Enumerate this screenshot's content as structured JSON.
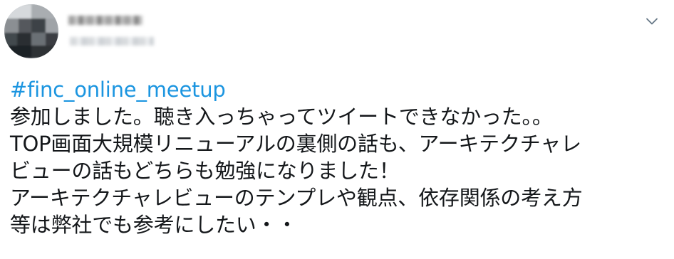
{
  "author": {
    "avatar_icon": "blurred-profile-photo",
    "display_name": "",
    "handle": ""
  },
  "menu": {
    "icon": "chevron-down-icon"
  },
  "tweet": {
    "hashtag": "#finc_online_meetup",
    "lines": [
      "参加しました。聴き入っちゃってツイートできなかった。。",
      "TOP画面大規模リニューアルの裏側の話も、アーキテクチャレ",
      "ビューの話もどちらも勉強になりました！",
      "アーキテクチャレビューのテンプレや観点、依存関係の考え方",
      "等は弊社でも参考にしたい・・"
    ]
  },
  "colors": {
    "link": "#1b95e0",
    "text": "#14171a",
    "icon": "#657786"
  }
}
